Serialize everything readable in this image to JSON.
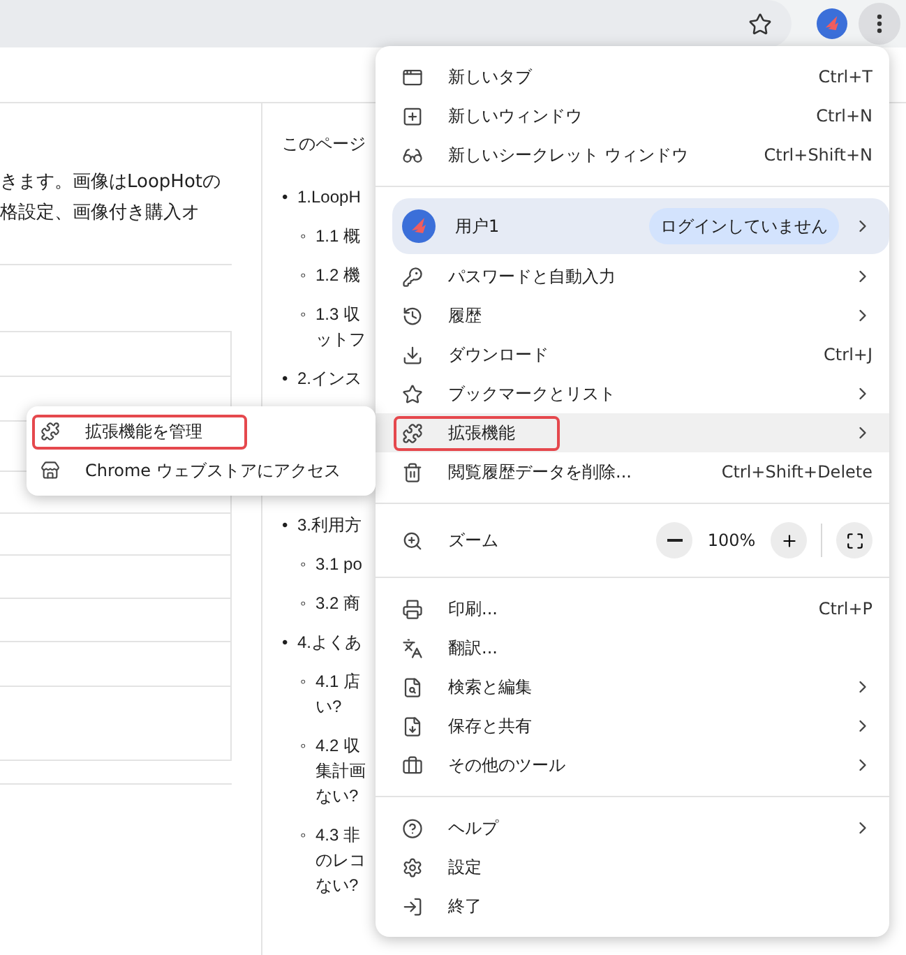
{
  "page": {
    "paragraph_lines": [
      "きます。画像はLoopHotの",
      "格設定、画像付き購入オ"
    ],
    "toc_title": "このページ",
    "toc": [
      {
        "marker": "•",
        "lines": [
          "1.LoopH"
        ],
        "children": [
          {
            "marker": "◦",
            "lines": [
              "1.1 概"
            ]
          },
          {
            "marker": "◦",
            "lines": [
              "1.2 機"
            ]
          },
          {
            "marker": "◦",
            "lines": [
              "1.3 収",
              "ットフ"
            ]
          }
        ]
      },
      {
        "marker": "•",
        "lines": [
          "2.インス"
        ]
      },
      {
        "marker": "•",
        "lines": [
          "3.利用方"
        ],
        "children": [
          {
            "marker": "◦",
            "lines": [
              "3.1 po"
            ]
          },
          {
            "marker": "◦",
            "lines": [
              "3.2 商"
            ]
          }
        ]
      },
      {
        "marker": "•",
        "lines": [
          "4.よくあ"
        ],
        "children": [
          {
            "marker": "◦",
            "lines": [
              "4.1 店",
              "い?"
            ]
          },
          {
            "marker": "◦",
            "lines": [
              "4.2 収",
              "集計画",
              "ない?"
            ]
          },
          {
            "marker": "◦",
            "lines": [
              "4.3 非",
              "のレコ",
              "ない?"
            ]
          }
        ]
      }
    ]
  },
  "menu": {
    "items": [
      {
        "kind": "item",
        "label": "新しいタブ",
        "shortcut": "Ctrl+T",
        "submenu": false,
        "highlighted": false,
        "outlined": false
      },
      {
        "kind": "item",
        "label": "新しいウィンドウ",
        "shortcut": "Ctrl+N",
        "submenu": false,
        "highlighted": false,
        "outlined": false
      },
      {
        "kind": "item",
        "label": "新しいシークレット ウィンドウ",
        "shortcut": "Ctrl+Shift+N",
        "submenu": false,
        "highlighted": false,
        "outlined": false
      },
      {
        "kind": "divider"
      },
      {
        "kind": "profile",
        "label": "用户1",
        "badge": "ログインしていません"
      },
      {
        "kind": "item",
        "label": "パスワードと自動入力",
        "submenu": true,
        "highlighted": false,
        "outlined": false
      },
      {
        "kind": "item",
        "label": "履歴",
        "submenu": true,
        "highlighted": false,
        "outlined": false
      },
      {
        "kind": "item",
        "label": "ダウンロード",
        "shortcut": "Ctrl+J",
        "submenu": false,
        "highlighted": false,
        "outlined": false
      },
      {
        "kind": "item",
        "label": "ブックマークとリスト",
        "submenu": true,
        "highlighted": false,
        "outlined": false
      },
      {
        "kind": "item",
        "label": "拡張機能",
        "submenu": true,
        "highlighted": true,
        "outlined": true
      },
      {
        "kind": "item",
        "label": "閲覧履歴データを削除...",
        "shortcut": "Ctrl+Shift+Delete",
        "submenu": false,
        "highlighted": false,
        "outlined": false
      },
      {
        "kind": "divider"
      },
      {
        "kind": "zoom",
        "label": "ズーム",
        "value": "100%"
      },
      {
        "kind": "divider"
      },
      {
        "kind": "item",
        "label": "印刷...",
        "shortcut": "Ctrl+P",
        "submenu": false,
        "highlighted": false,
        "outlined": false
      },
      {
        "kind": "item",
        "label": "翻訳...",
        "submenu": false,
        "highlighted": false,
        "outlined": false
      },
      {
        "kind": "item",
        "label": "検索と編集",
        "submenu": true,
        "highlighted": false,
        "outlined": false
      },
      {
        "kind": "item",
        "label": "保存と共有",
        "submenu": true,
        "highlighted": false,
        "outlined": false
      },
      {
        "kind": "item",
        "label": "その他のツール",
        "submenu": true,
        "highlighted": false,
        "outlined": false
      },
      {
        "kind": "divider"
      },
      {
        "kind": "item",
        "label": "ヘルプ",
        "submenu": true,
        "highlighted": false,
        "outlined": false
      },
      {
        "kind": "item",
        "label": "設定",
        "submenu": false,
        "highlighted": false,
        "outlined": false
      },
      {
        "kind": "item",
        "label": "終了",
        "submenu": false,
        "highlighted": false,
        "outlined": false
      }
    ]
  },
  "submenu": {
    "items": [
      {
        "label": "拡張機能を管理",
        "outlined": true
      },
      {
        "label": "Chrome ウェブストアにアクセス",
        "outlined": false
      }
    ]
  }
}
